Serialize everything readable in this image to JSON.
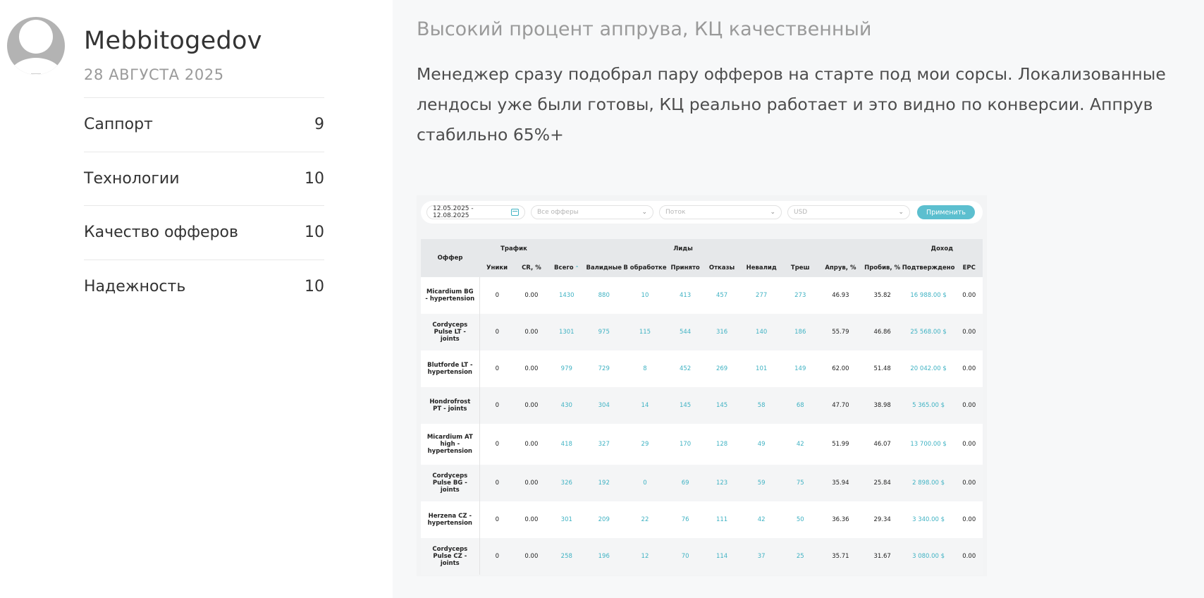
{
  "profile": {
    "username": "Mebbitogedov",
    "date": "28 АВГУСТА 2025",
    "ratings": [
      {
        "label": "Саппорт",
        "value": "9"
      },
      {
        "label": "Технологии",
        "value": "10"
      },
      {
        "label": "Качество офферов",
        "value": "10"
      },
      {
        "label": "Надежность",
        "value": "10"
      }
    ]
  },
  "review": {
    "title": "Высокий процент аппрува, КЦ качественный",
    "text": "Менеджер сразу подобрал пару офферов на старте под мои сорсы. Локализованные лендосы уже были готовы, КЦ реально работает и это видно по конверсии. Аппрув стабильно 65%+"
  },
  "screenshot": {
    "filters": {
      "date_range": "12.05.2025 - 12.08.2025",
      "offers_placeholder": "Все офферы",
      "flow_placeholder": "Поток",
      "currency_placeholder": "USD",
      "apply_label": "Применить"
    },
    "groups": {
      "offer": "Оффер",
      "traffic": "Трафик",
      "leads": "Лиды",
      "income": "Доход"
    },
    "columns": [
      "Уники",
      "CR, %",
      "Всего",
      "Валидные",
      "В обработке",
      "Принято",
      "Отказы",
      "Невалид",
      "Треш",
      "Апрув, %",
      "Пробив, %",
      "Подтверждено",
      "EPC"
    ],
    "rows": [
      {
        "offer": "Micardium BG - hypertension",
        "cells": [
          "0",
          "0.00",
          "1430",
          "880",
          "10",
          "413",
          "457",
          "277",
          "273",
          "46.93",
          "35.82",
          "16 988.00 $",
          "0.00"
        ]
      },
      {
        "offer": "Cordyceps Pulse LT - joints",
        "cells": [
          "0",
          "0.00",
          "1301",
          "975",
          "115",
          "544",
          "316",
          "140",
          "186",
          "55.79",
          "46.86",
          "25 568.00 $",
          "0.00"
        ]
      },
      {
        "offer": "Blutforde LT - hypertension",
        "cells": [
          "0",
          "0.00",
          "979",
          "729",
          "8",
          "452",
          "269",
          "101",
          "149",
          "62.00",
          "51.48",
          "20 042.00 $",
          "0.00"
        ]
      },
      {
        "offer": "Hondrofrost PT - joints",
        "cells": [
          "0",
          "0.00",
          "430",
          "304",
          "14",
          "145",
          "145",
          "58",
          "68",
          "47.70",
          "38.98",
          "5 365.00 $",
          "0.00"
        ]
      },
      {
        "offer": "Micardium AT high - hypertension",
        "cells": [
          "0",
          "0.00",
          "418",
          "327",
          "29",
          "170",
          "128",
          "49",
          "42",
          "51.99",
          "46.07",
          "13 700.00 $",
          "0.00"
        ]
      },
      {
        "offer": "Cordyceps Pulse BG - joints",
        "cells": [
          "0",
          "0.00",
          "326",
          "192",
          "0",
          "69",
          "123",
          "59",
          "75",
          "35.94",
          "25.84",
          "2 898.00 $",
          "0.00"
        ]
      },
      {
        "offer": "Herzena CZ - hypertension",
        "cells": [
          "0",
          "0.00",
          "301",
          "209",
          "22",
          "76",
          "111",
          "42",
          "50",
          "36.36",
          "29.34",
          "3 340.00 $",
          "0.00"
        ]
      },
      {
        "offer": "Cordyceps Pulse CZ - joints",
        "cells": [
          "0",
          "0.00",
          "258",
          "196",
          "12",
          "70",
          "114",
          "37",
          "25",
          "35.71",
          "31.67",
          "3 080.00 $",
          "0.00"
        ]
      }
    ]
  }
}
